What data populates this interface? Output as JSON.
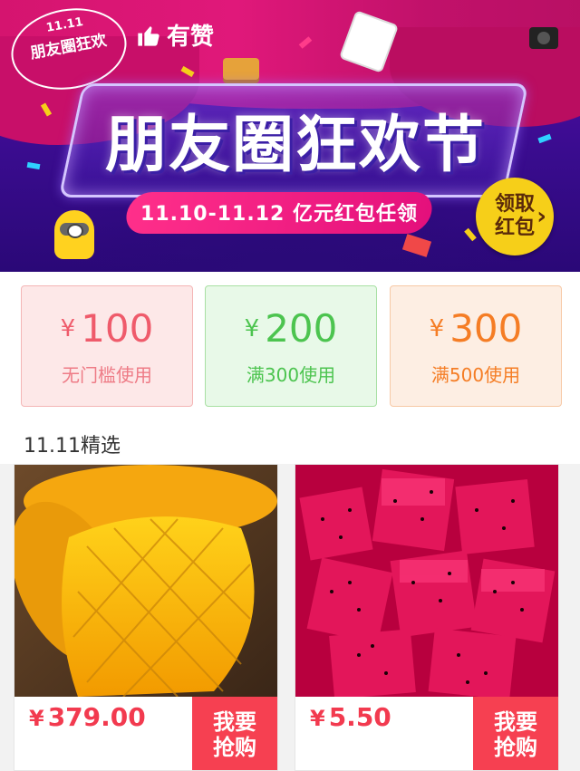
{
  "banner": {
    "badge_number": "11.11",
    "badge_text": "朋友圈狂欢",
    "brand": "有赞",
    "title": "朋友圈狂欢节",
    "date_text": "11.10-11.12  亿元红包任领",
    "claim_line1": "领取",
    "claim_line2": "红包"
  },
  "coupons": [
    {
      "currency": "¥",
      "amount": "100",
      "condition": "无门槛使用"
    },
    {
      "currency": "¥",
      "amount": "200",
      "condition": "满300使用"
    },
    {
      "currency": "¥",
      "amount": "300",
      "condition": "满500使用"
    }
  ],
  "section": {
    "title": "11.11精选"
  },
  "products": [
    {
      "currency": "¥",
      "price": "379.00",
      "buy_line1": "我要",
      "buy_line2": "抢购"
    },
    {
      "currency": "¥",
      "price": "5.50",
      "buy_line1": "我要",
      "buy_line2": "抢购"
    }
  ],
  "colors": {
    "accent_red": "#f64051",
    "coupon_red": "#ef5b6b",
    "coupon_green": "#4cc44f",
    "coupon_orange": "#f57d25",
    "banner_purple": "#4a0ea0",
    "banner_pink": "#e0187a"
  }
}
